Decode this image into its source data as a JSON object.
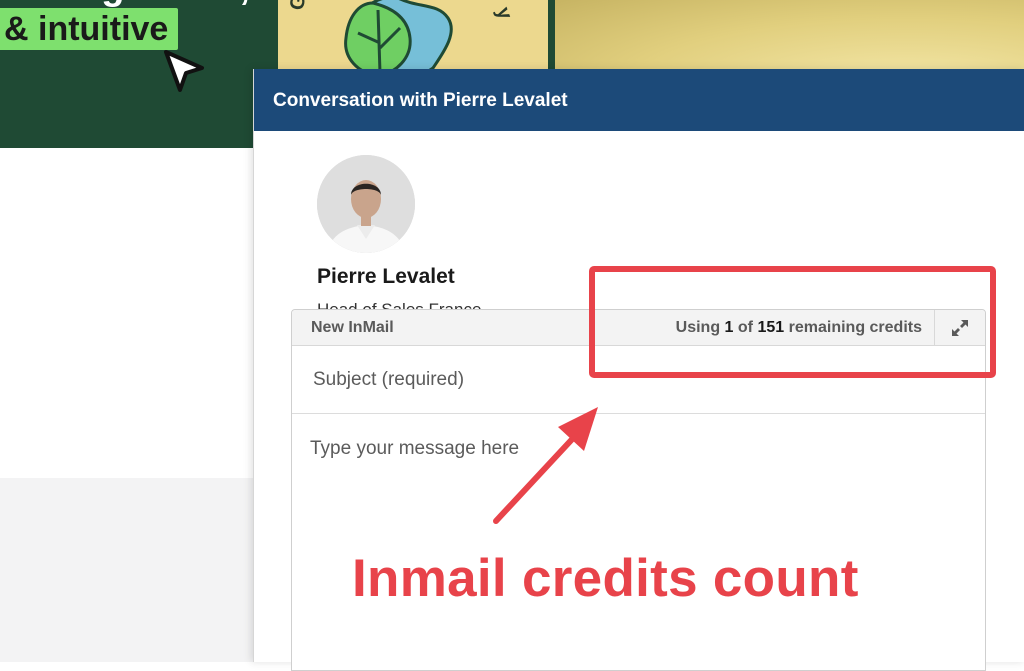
{
  "background": {
    "highlight_text": "& intuitive",
    "badge_letters": [
      "Gro",
      "y"
    ],
    "colors": {
      "banner": "#1f4a34",
      "highlight": "#7ee06e",
      "yellow": "#e1cf7e"
    }
  },
  "modal": {
    "title": "Conversation with Pierre Levalet",
    "header_color": "#1c4a79",
    "profile": {
      "name": "Pierre Levalet",
      "headline": "Head of Sales France",
      "avatar_icon": "person-photo"
    },
    "composer": {
      "label": "New InMail",
      "credits": {
        "prefix": "Using",
        "used": "1",
        "of": "of",
        "remaining": "151",
        "suffix": "remaining credits"
      },
      "expand_icon": "expand-arrows-icon",
      "subject_placeholder": "Subject (required)",
      "message_placeholder": "Type your message here"
    }
  },
  "annotation": {
    "label": "Inmail credits count",
    "color": "#e8434a"
  }
}
